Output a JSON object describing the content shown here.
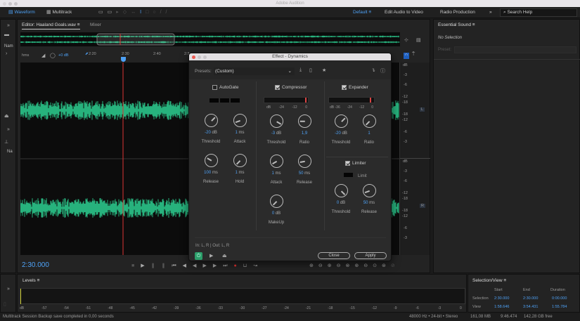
{
  "app_title": "Adobe Audition",
  "toolbar": {
    "waveform": "Waveform",
    "multitrack": "Multitrack",
    "workspaces": [
      "Default",
      "Edit Audio to Video",
      "Radio Production"
    ],
    "search_placeholder": "Search Help"
  },
  "left_panel": {
    "label1": "Nam",
    "label2": "Na"
  },
  "editor": {
    "tab": "Editor: Haaland Goals.wav",
    "mixer": "Mixer",
    "ruler_unit": "hms",
    "gain": "+0 dB",
    "ruler_ticks": [
      "2:20",
      "2:30",
      "2:40",
      "2:5"
    ],
    "current_time": "2:30.000",
    "db_scale": [
      "dB",
      "-3",
      "-6",
      "-12",
      "-18",
      "-18",
      "-12",
      "-6",
      "-3"
    ],
    "channels": [
      "L",
      "R"
    ]
  },
  "essential_sound": {
    "title": "Essential Sound",
    "no_selection": "No Selection",
    "preset_label": "Preset:"
  },
  "dialog": {
    "title": "Effect - Dynamics",
    "presets_label": "Presets:",
    "preset_value": "(Custom)",
    "autogate": {
      "label": "AutoGate",
      "checked": false,
      "knobs": [
        {
          "value": "-20",
          "unit": " dB",
          "label": "Threshold"
        },
        {
          "value": "1",
          "unit": " ms",
          "label": "Attack"
        },
        {
          "value": "100",
          "unit": " ms",
          "label": "Release"
        },
        {
          "value": "1",
          "unit": " ms",
          "label": "Hold"
        }
      ]
    },
    "compressor": {
      "label": "Compressor",
      "checked": true,
      "scale": [
        "dB",
        "-24",
        "-12",
        "0"
      ],
      "knobs": [
        {
          "value": "-3",
          "unit": " dB",
          "label": "Threshold"
        },
        {
          "value": "1,9",
          "unit": "",
          "label": "Ratio"
        },
        {
          "value": "1",
          "unit": " ms",
          "label": "Attack"
        },
        {
          "value": "50",
          "unit": " ms",
          "label": "Release"
        },
        {
          "value": "0",
          "unit": " dB",
          "label": "MakeUp"
        }
      ]
    },
    "expander": {
      "label": "Expander",
      "checked": true,
      "scale": [
        "dB -36",
        "-24",
        "-12",
        "0"
      ],
      "knobs": [
        {
          "value": "-20",
          "unit": " dB",
          "label": "Threshold"
        },
        {
          "value": "1",
          "unit": "",
          "label": "Ratio"
        }
      ]
    },
    "limiter": {
      "label": "Limiter",
      "checked": true,
      "limit": "Limit",
      "knobs": [
        {
          "value": "0",
          "unit": " dB",
          "label": "Threshold"
        },
        {
          "value": "50",
          "unit": " ms",
          "label": "Release"
        }
      ]
    },
    "io": "In: L, R | Out: L, R",
    "close": "Close",
    "apply": "Apply"
  },
  "levels": {
    "title": "Levels",
    "scale": [
      "dB",
      "-57",
      "-54",
      "-51",
      "-48",
      "-45",
      "-42",
      "-39",
      "-36",
      "-33",
      "-30",
      "-27",
      "-24",
      "-21",
      "-18",
      "-15",
      "-12",
      "-9",
      "-6",
      "-3",
      "0"
    ]
  },
  "selection_view": {
    "title": "Selection/View",
    "headers": [
      "Start",
      "End",
      "Duration"
    ],
    "rows": [
      {
        "label": "Selection",
        "start": "2:30.000",
        "end": "2:30.000",
        "duration": "0:00.000"
      },
      {
        "label": "View",
        "start": "1:58.646",
        "end": "3:54.431",
        "duration": "1:55.784"
      }
    ]
  },
  "status": {
    "message": "Multitrack Session Backup save completed in 0,00 seconds",
    "format": "48000 Hz • 24-bit • Stereo",
    "size": "161,08 MB",
    "duration": "9:46.474",
    "free": "142,28 GB free"
  },
  "colors": {
    "accent": "#4ea1f5",
    "wave": "#2fdc9a",
    "playhead": "#d33"
  }
}
